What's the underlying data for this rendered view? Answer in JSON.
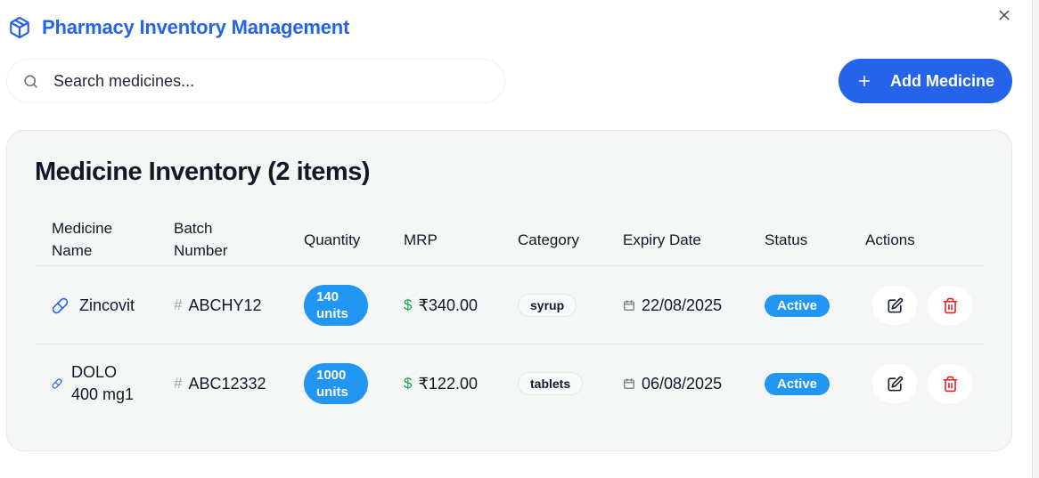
{
  "app": {
    "title": "Pharmacy Inventory Management",
    "logo_icon": "package-icon",
    "accent_color": "#2563eb"
  },
  "search": {
    "placeholder": "Search medicines...",
    "value": ""
  },
  "toolbar": {
    "add_label": "Add Medicine"
  },
  "inventory": {
    "heading": "Medicine Inventory (2 items)",
    "columns": {
      "name": "Medicine Name",
      "batch": "Batch Number",
      "quantity": "Quantity",
      "mrp": "MRP",
      "category": "Category",
      "expiry": "Expiry Date",
      "status": "Status",
      "actions": "Actions"
    },
    "rows": [
      {
        "name": "Zincovit",
        "batch": "ABCHY12",
        "quantity": "140",
        "unit": "units",
        "mrp": "₹340.00",
        "category": "syrup",
        "expiry": "22/08/2025",
        "status": "Active"
      },
      {
        "name": "DOLO 400 mg1",
        "batch": "ABC12332",
        "quantity": "1000",
        "unit": "units",
        "mrp": "₹122.00",
        "category": "tablets",
        "expiry": "06/08/2025",
        "status": "Active"
      }
    ]
  },
  "symbols": {
    "hash": "#",
    "dollar": "$"
  },
  "colors": {
    "badge_blue": "#2196f3",
    "price_green": "#16a34a",
    "delete_red": "#dc2626"
  }
}
